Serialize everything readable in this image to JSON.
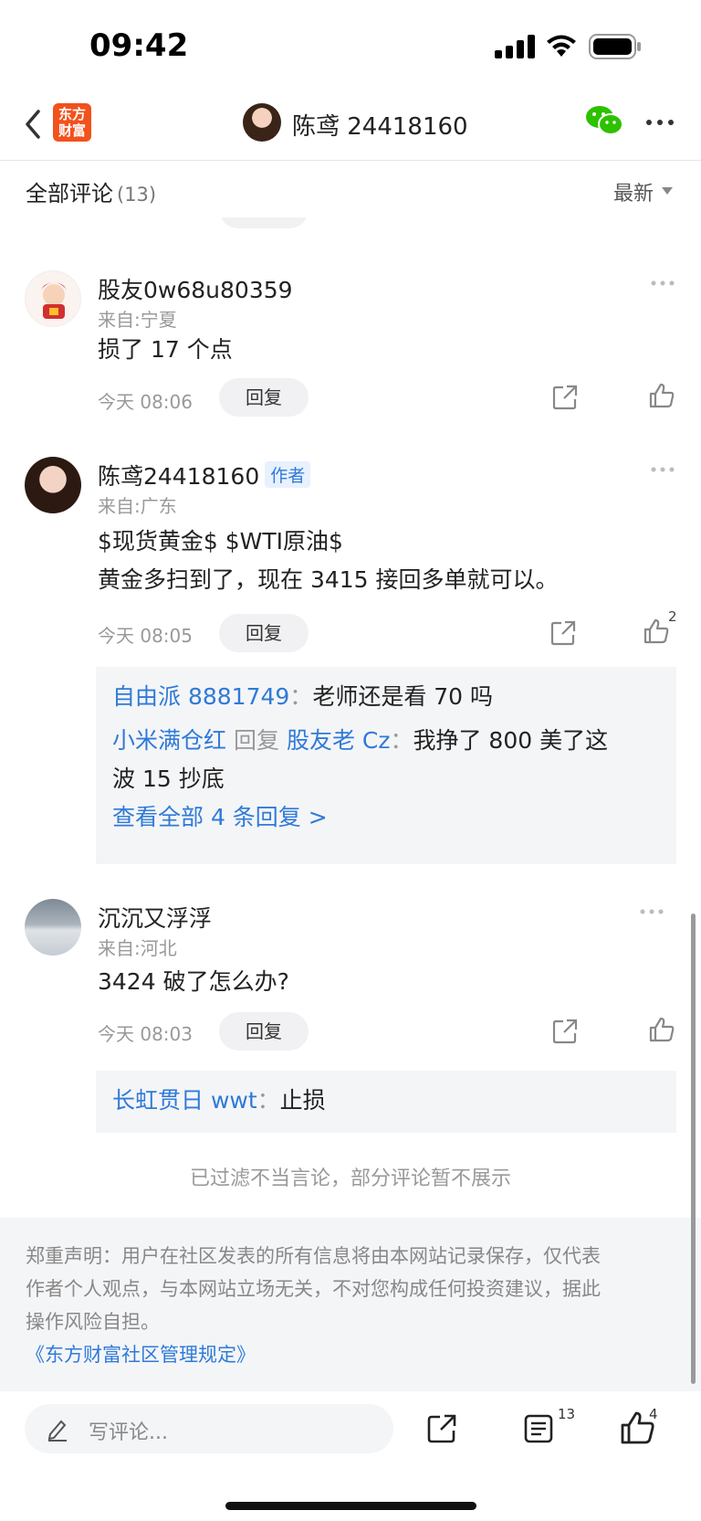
{
  "status_bar": {
    "time": "09:42"
  },
  "nav": {
    "logo_line1": "东方",
    "logo_line2": "财富",
    "title": "陈鸢 24418160"
  },
  "sub_header": {
    "title": "全部评论",
    "count": "(13)",
    "sort": "最新"
  },
  "comments": [
    {
      "username": "股友0w68u80359",
      "origin": "来自:宁夏",
      "body": [
        "损了 17 个点"
      ],
      "time": "今天 08:06",
      "reply_label": "回复"
    },
    {
      "username": "陈鸢24418160",
      "badge": "作者",
      "origin": "来自:广东",
      "body": [
        "$现货黄金$ $WTI原油$",
        "黄金多扫到了，现在 3415 接回多单就可以。"
      ],
      "time": "今天 08:05",
      "reply_label": "回复",
      "likes": "2",
      "replies": [
        {
          "user": "自由派 8881749",
          "sep": "：",
          "text": "老师还是看 70 吗"
        },
        {
          "user": "小米满仓红",
          "mid": "回复",
          "target": "股友老 Cz",
          "sep": "：",
          "text": "我挣了 800 美了这",
          "text2": "波 15 抄底"
        }
      ],
      "view_all": "查看全部 4 条回复 >"
    },
    {
      "username": "沉沉又浮浮",
      "origin": "来自:河北",
      "body": [
        "3424 破了怎么办?"
      ],
      "time": "今天 08:03",
      "reply_label": "回复",
      "replies": [
        {
          "user": "长虹贯日 wwt",
          "sep": "：",
          "text": "止损"
        }
      ]
    }
  ],
  "filter_note": "已过滤不当言论，部分评论暂不展示",
  "disclaimer": {
    "line1": "郑重声明：用户在社区发表的所有信息将由本网站记录保存，仅代表",
    "line2": "作者个人观点，与本网站立场无关，不对您构成任何投资建议，据此",
    "line3": "操作风险自担。",
    "rules_link": "《东方财富社区管理规定》"
  },
  "bottom_bar": {
    "placeholder": "写评论...",
    "comment_count": "13",
    "like_count": "4"
  },
  "colors": {
    "link_blue": "#2f7ad8",
    "brand_orange": "#f2521c",
    "wechat_green": "#2dc100"
  }
}
